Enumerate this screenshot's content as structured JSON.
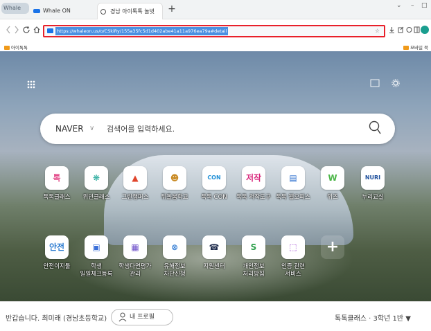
{
  "browser": {
    "logo_text": "Whale",
    "tabs": [
      {
        "label": "Whale ON"
      },
      {
        "label": "경남 아이톡톡 놀벗"
      }
    ],
    "new_tab": "+",
    "window_controls": {
      "minimize": "–",
      "maximize": "□",
      "collapse": "⌄"
    },
    "address": {
      "url": "https://whaleon.us/o/CSkiRy/155a35fc5d1d402abe41a11a976ea79a#detail"
    },
    "bookmarks": [
      {
        "label": "아이톡톡"
      },
      {
        "label": "모바일 북마"
      }
    ]
  },
  "icons": {
    "back": "chevron-left-icon",
    "forward": "chevron-right-icon",
    "reload": "reload-icon",
    "home": "home-icon",
    "star": "star-icon",
    "download": "download-icon"
  },
  "search": {
    "engine": "NAVER",
    "placeholder": "검색어를 입력하세요."
  },
  "apps_row1": [
    {
      "label": "톡톡클래스",
      "glyph": "톡",
      "color": "#e34b8a"
    },
    {
      "label": "위민클래스",
      "glyph": "❋",
      "color": "#21a89a"
    },
    {
      "label": "그린캠퍼스",
      "glyph": "▲",
      "color": "#e0452c"
    },
    {
      "label": "뒤돌봄학교",
      "glyph": "☻",
      "color": "#c98b25"
    },
    {
      "label": "톡톡 CON",
      "glyph": "CON",
      "color": "#1e8fd6"
    },
    {
      "label": "톡톡 저작도구",
      "glyph": "저작",
      "color": "#d8267b"
    },
    {
      "label": "톡톡 웹오피스",
      "glyph": "▤",
      "color": "#2d6fcf"
    },
    {
      "label": "위즈",
      "glyph": "W",
      "color": "#4cb648"
    },
    {
      "label": "누리교실",
      "glyph": "NURI",
      "color": "#1d4f9c"
    }
  ],
  "apps_row2": [
    {
      "label": "안전이지툴",
      "glyph": "안전",
      "color": "#2e7dd1"
    },
    {
      "label": "학생\n일일체크등록",
      "glyph": "▣",
      "color": "#3a6fd8"
    },
    {
      "label": "학생다면평가\n관리",
      "glyph": "▦",
      "color": "#6d4fc9"
    },
    {
      "label": "유해정보\n차단신청",
      "glyph": "⊗",
      "color": "#3b82d6"
    },
    {
      "label": "지원센터",
      "glyph": "☎",
      "color": "#1f2c4d"
    },
    {
      "label": "개인정보\n처리방침",
      "glyph": "S",
      "color": "#2fa14d"
    },
    {
      "label": "인증 관련\n서비스",
      "glyph": "⬚",
      "color": "#9a3fd0"
    },
    {
      "label": "",
      "glyph": "+",
      "color": "#2d7be0"
    }
  ],
  "footer": {
    "greeting": "반갑습니다. 최미래 (경남초등학교)",
    "my_profile": "내 프로필",
    "class_selector": "톡톡클래스 · 3학년 1반 ▼"
  }
}
